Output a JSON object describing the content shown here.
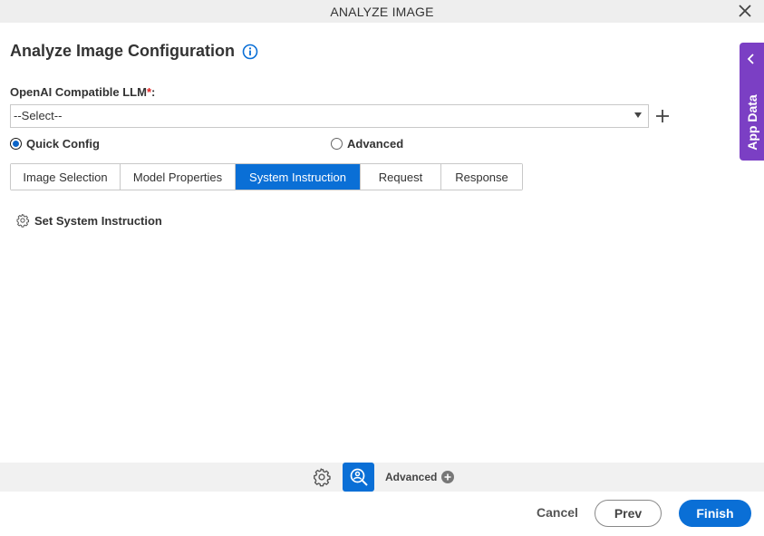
{
  "window": {
    "title": "ANALYZE IMAGE"
  },
  "page": {
    "heading": "Analyze Image Configuration"
  },
  "llm": {
    "label": "OpenAI Compatible LLM",
    "required_mark": "*",
    "suffix": ":",
    "selected": "--Select--"
  },
  "config_mode": {
    "quick_label": "Quick Config",
    "advanced_label": "Advanced",
    "selected": "quick"
  },
  "tabs": [
    {
      "label": "Image Selection",
      "active": false
    },
    {
      "label": "Model Properties",
      "active": false
    },
    {
      "label": "System Instruction",
      "active": true
    },
    {
      "label": "Request",
      "active": false
    },
    {
      "label": "Response",
      "active": false
    }
  ],
  "content": {
    "set_instruction_label": "Set System Instruction"
  },
  "side_panel": {
    "label": "App Data"
  },
  "bottom_toolbar": {
    "advanced_label": "Advanced"
  },
  "footer": {
    "cancel": "Cancel",
    "prev": "Prev",
    "finish": "Finish"
  },
  "colors": {
    "accent": "#0a6fd6",
    "side_panel": "#7b3fc4",
    "required": "#e02020"
  }
}
